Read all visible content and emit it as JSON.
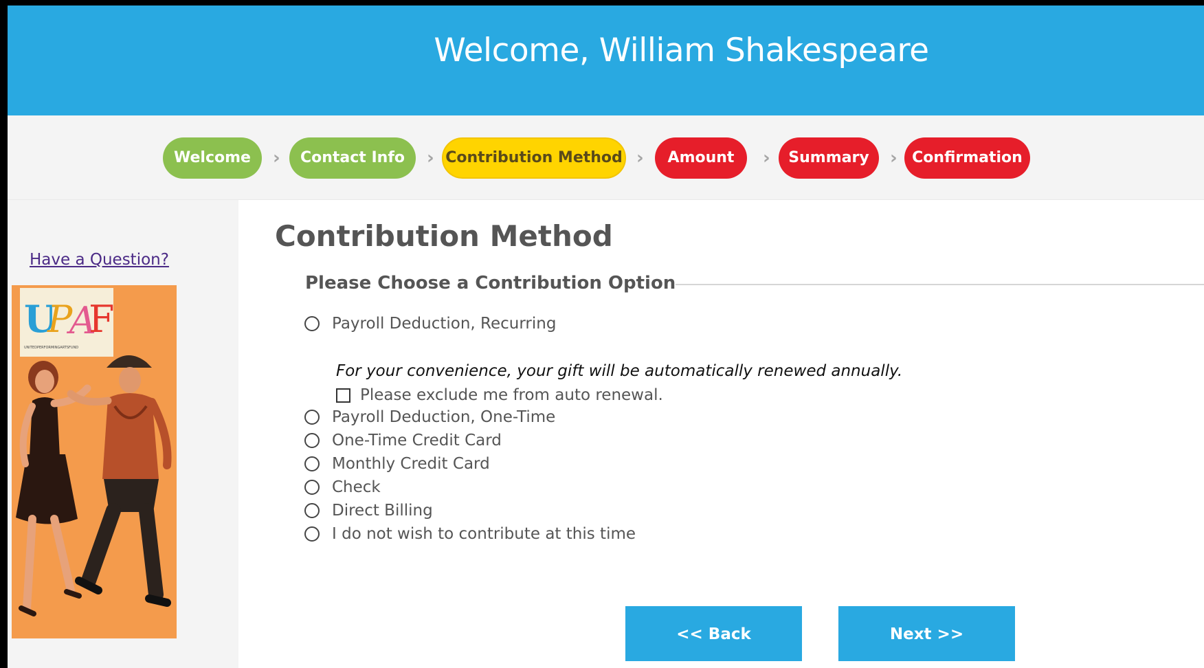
{
  "header": {
    "title": "Welcome, William Shakespeare"
  },
  "steps": [
    {
      "label": "Welcome",
      "state": "done"
    },
    {
      "label": "Contact Info",
      "state": "done"
    },
    {
      "label": "Contribution Method",
      "state": "current"
    },
    {
      "label": "Amount",
      "state": "todo"
    },
    {
      "label": "Summary",
      "state": "todo"
    },
    {
      "label": "Confirmation",
      "state": "todo"
    }
  ],
  "sidebar": {
    "question_link": "Have a Question?",
    "poster_logo": "UPAF",
    "poster_tagline": "UNITEDPERFORMINGARTSFUND"
  },
  "main": {
    "title": "Contribution Method",
    "section_title": "Please Choose a Contribution Option",
    "options": [
      {
        "label": "Payroll Deduction, Recurring",
        "selected": false
      },
      {
        "label": "Payroll Deduction, One-Time",
        "selected": false
      },
      {
        "label": "One-Time Credit Card",
        "selected": false
      },
      {
        "label": "Monthly Credit Card",
        "selected": false
      },
      {
        "label": "Check",
        "selected": false
      },
      {
        "label": "Direct Billing",
        "selected": false
      },
      {
        "label": "I do not wish to contribute at this time",
        "selected": false
      }
    ],
    "renewal_note": "For your convenience, your gift will be automatically renewed annually.",
    "exclude_label": "Please exclude me from auto renewal.",
    "exclude_checked": false,
    "back_label": "<< Back",
    "next_label": "Next >>"
  },
  "colors": {
    "header_blue": "#29a9e1",
    "step_done": "#8cc04f",
    "step_current": "#ffd400",
    "step_todo": "#e61e2a",
    "poster_orange": "#f49b4c"
  }
}
